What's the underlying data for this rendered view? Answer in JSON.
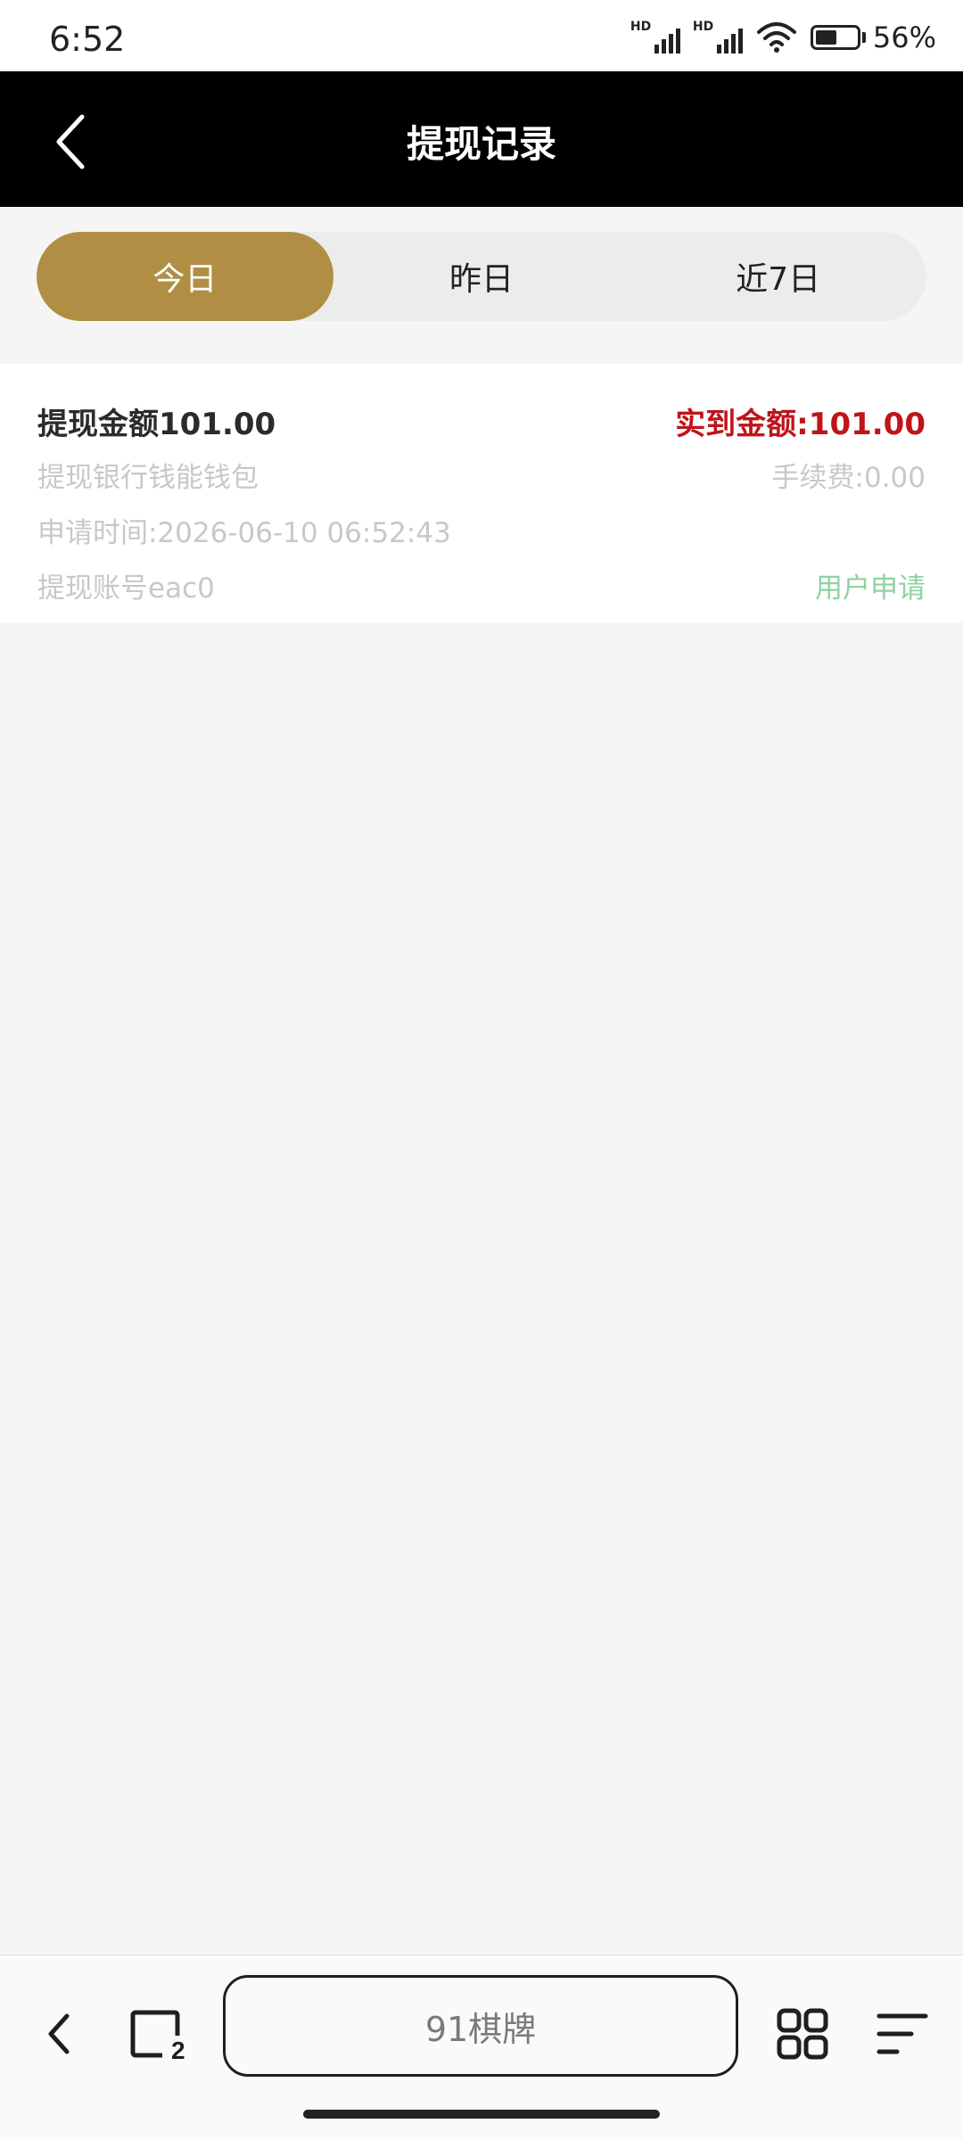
{
  "status_bar": {
    "time": "6:52",
    "signal1_label": "HD",
    "signal2_label": "HD",
    "battery_percent": "56%"
  },
  "header": {
    "title": "提现记录"
  },
  "tabs": [
    {
      "label": "今日",
      "active": true
    },
    {
      "label": "昨日",
      "active": false
    },
    {
      "label": "近7日",
      "active": false
    }
  ],
  "record": {
    "amount": "提现金额101.00",
    "actual_amount": "实到金额:101.00",
    "bank": "提现银行钱能钱包",
    "fee": "手续费:0.00",
    "apply_time": "申请时间:2026-06-10 06:52:43",
    "account": "提现账号eac0",
    "status": "用户申请"
  },
  "browser": {
    "url_text": "91棋牌",
    "tab_count": "2"
  },
  "colors": {
    "header_bg": "#000000",
    "accent": "#b08f45",
    "actual_amount": "#c0141a",
    "status": "#8dd3a2"
  }
}
